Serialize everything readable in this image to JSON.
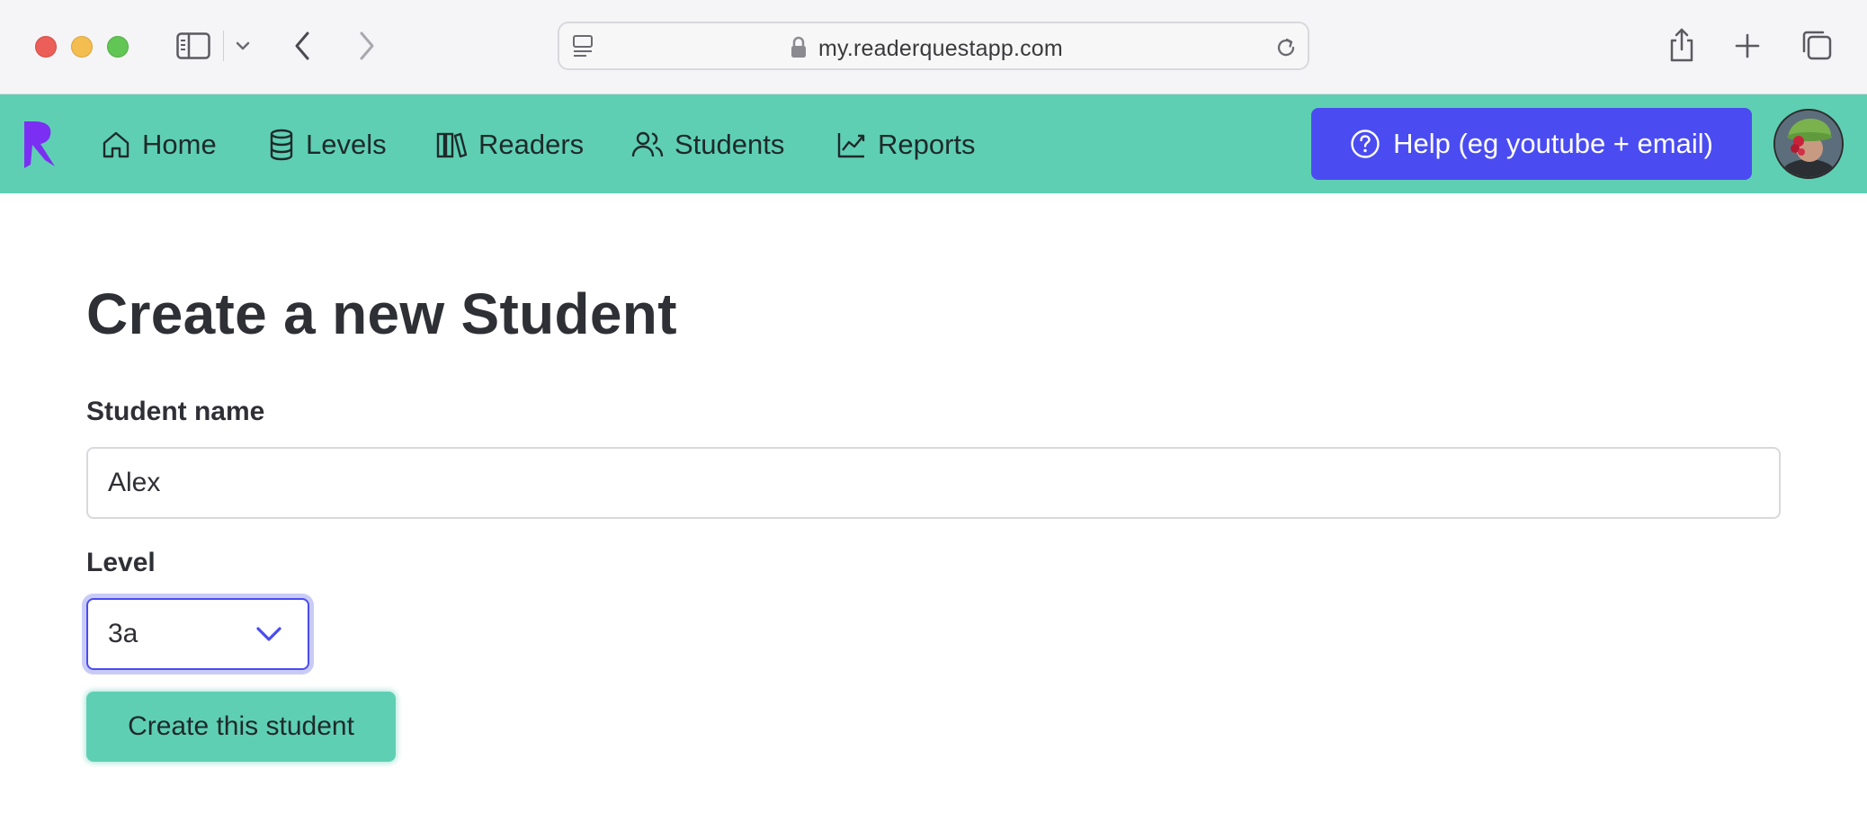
{
  "browser": {
    "url": "my.readerquestapp.com",
    "icons": [
      "sidebar-icon",
      "chevron-down-icon",
      "back-icon",
      "forward-icon",
      "reader-icon",
      "lock-icon",
      "reload-icon",
      "share-icon",
      "plus-icon",
      "tabs-icon"
    ]
  },
  "nav": {
    "items": [
      {
        "label": "Home",
        "icon": "home-icon"
      },
      {
        "label": "Levels",
        "icon": "database-icon"
      },
      {
        "label": "Readers",
        "icon": "books-icon"
      },
      {
        "label": "Students",
        "icon": "users-icon"
      },
      {
        "label": "Reports",
        "icon": "chart-line-icon"
      }
    ],
    "help_label": "Help (eg youtube + email)",
    "help_icon": "question-circle-icon",
    "colors": {
      "nav_bg": "#5fcfb4",
      "help_bg": "#4a4cf1",
      "logo": "#7b2ff2"
    }
  },
  "form": {
    "title": "Create a new Student",
    "name_label": "Student name",
    "name_value": "Alex",
    "level_label": "Level",
    "level_value": "3a",
    "submit_label": "Create this student"
  }
}
